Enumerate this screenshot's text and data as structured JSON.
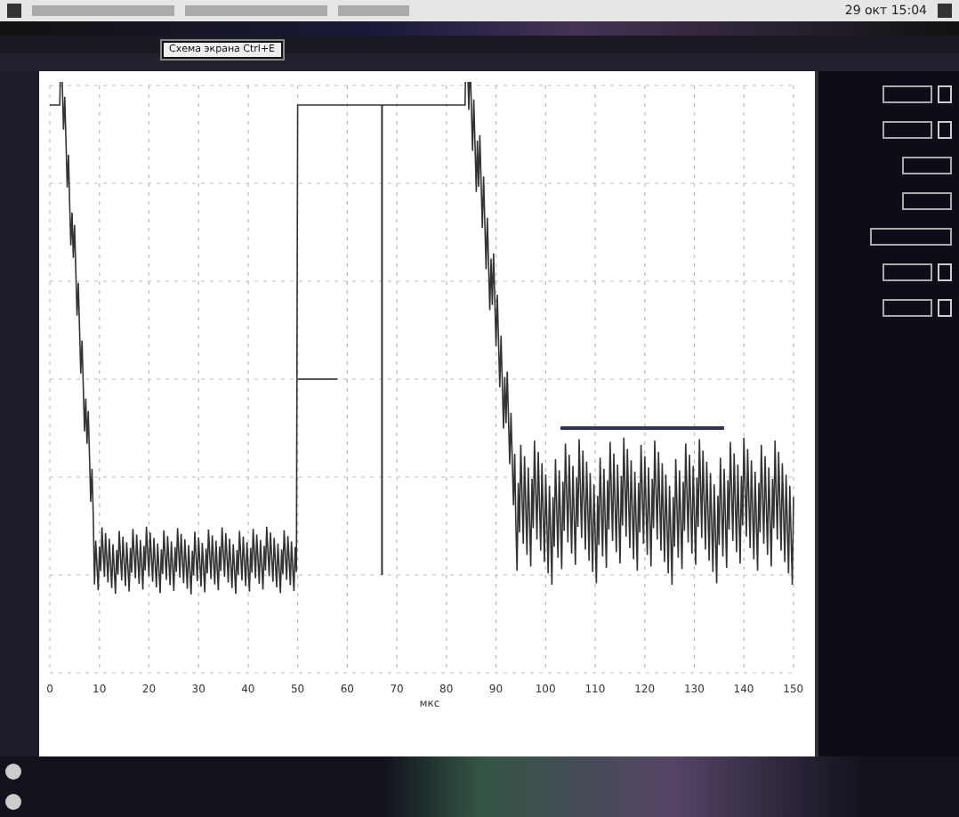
{
  "taskbar": {
    "clock": "29 окт 15:04"
  },
  "menu_popup": {
    "items": [
      {
        "label": "Схема экрана Ctrl+E",
        "selected": true
      }
    ]
  },
  "plot": {
    "x_ticks": [
      "0",
      "10",
      "20",
      "30",
      "40",
      "50",
      "60",
      "70",
      "80",
      "90",
      "100",
      "110",
      "120",
      "130",
      "140",
      "150"
    ],
    "x_label": "мкс"
  }
}
